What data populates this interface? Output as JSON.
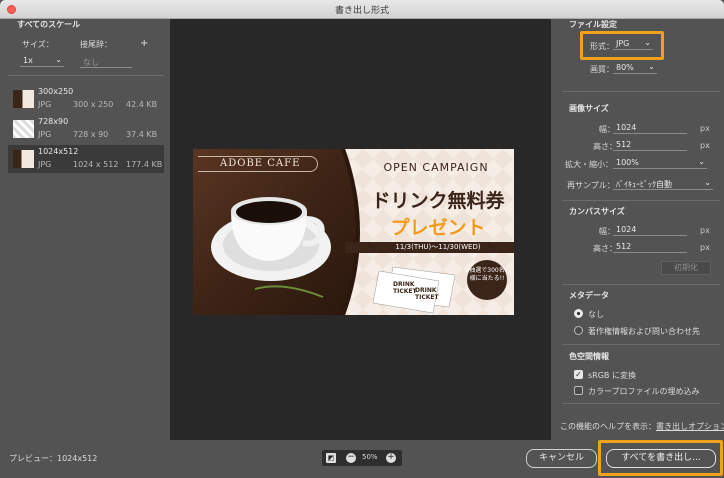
{
  "window": {
    "title": "書き出し形式"
  },
  "left": {
    "all_scales": "すべてのスケール",
    "size_label": "サイズ：",
    "suffix_label": "接尾辞：",
    "add": "+",
    "size_value": "1x",
    "suffix_placeholder": "なし",
    "scales": [
      {
        "name": "300x250",
        "format": "JPG",
        "dims": "300 x 250",
        "filesize": "42.4 KB"
      },
      {
        "name": "728x90",
        "format": "JPG",
        "dims": "728 x 90",
        "filesize": "37.4 KB"
      },
      {
        "name": "1024x512",
        "format": "JPG",
        "dims": "1024 x 512",
        "filesize": "177.4 KB"
      }
    ]
  },
  "banner": {
    "brand": "ADOBE CAFE",
    "campaign": "OPEN CAMPAIGN",
    "headline": "ドリンク無料券",
    "subhead": "プレゼント",
    "period": "11/3(THU)〜11/30(WED)",
    "ticket1": "DRINK TICKET",
    "ticket2": "DRINK TICKET",
    "badge": "抽選で300名様に当たる!!"
  },
  "right": {
    "file_settings": "ファイル設定",
    "format_label": "形式：",
    "format_value": "JPG",
    "quality_label": "画質：",
    "quality_value": "80%",
    "image_size": "画像サイズ",
    "width_label": "幅：",
    "width_value": "1024",
    "height_label": "高さ：",
    "height_value": "512",
    "unit": "px",
    "scale_label": "拡大・縮小：",
    "scale_value": "100%",
    "resample_label": "再サンプル：",
    "resample_value": "ﾊﾞｲｷｭｰﾋﾞｯｸ自動",
    "canvas_size": "カンバスサイズ",
    "canvas_width_value": "1024",
    "canvas_height_value": "512",
    "reset": "初期化",
    "metadata": "メタデータ",
    "meta_none": "なし",
    "meta_copyright": "著作権情報および問い合わせ先",
    "color_info": "色空間情報",
    "srgb": "sRGB に変換",
    "embed_profile": "カラープロファイルの埋め込み",
    "help_prefix": "この機能のヘルプを表示：",
    "help_link": "書き出しオプション"
  },
  "bottom": {
    "preview_label": "プレビュー：1024x512",
    "zoom": "50%",
    "cancel": "キャンセル",
    "export_all": "すべてを書き出し..."
  },
  "colors": {
    "accent": "#f0a11a",
    "brand_brown": "#3b2418",
    "orange_text": "#f49b1a"
  }
}
